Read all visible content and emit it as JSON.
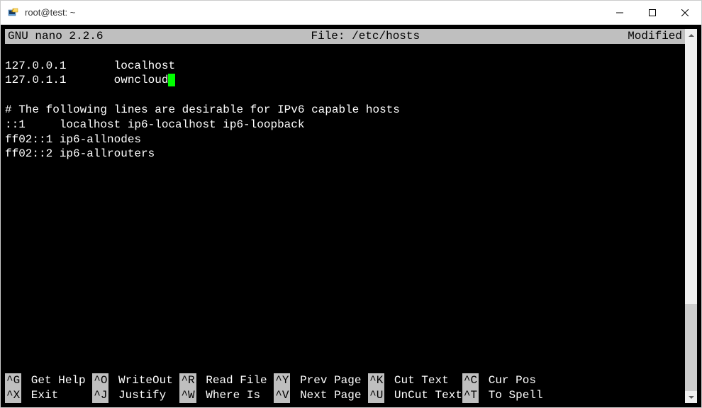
{
  "window": {
    "title": "root@test: ~"
  },
  "nano": {
    "version": "GNU nano 2.2.6",
    "file_label": "File: /etc/hosts",
    "status": "Modified"
  },
  "content": {
    "lines": [
      "",
      "127.0.0.1       localhost",
      "127.0.1.1       owncloud",
      "",
      "# The following lines are desirable for IPv6 capable hosts",
      "::1     localhost ip6-localhost ip6-loopback",
      "ff02::1 ip6-allnodes",
      "ff02::2 ip6-allrouters"
    ],
    "cursor_line": 2
  },
  "shortcuts": {
    "row1": [
      {
        "key": "^G",
        "label": "Get Help"
      },
      {
        "key": "^O",
        "label": "WriteOut"
      },
      {
        "key": "^R",
        "label": "Read File"
      },
      {
        "key": "^Y",
        "label": "Prev Page"
      },
      {
        "key": "^K",
        "label": "Cut Text"
      },
      {
        "key": "^C",
        "label": "Cur Pos"
      }
    ],
    "row2": [
      {
        "key": "^X",
        "label": "Exit"
      },
      {
        "key": "^J",
        "label": "Justify"
      },
      {
        "key": "^W",
        "label": "Where Is"
      },
      {
        "key": "^V",
        "label": "Next Page"
      },
      {
        "key": "^U",
        "label": "UnCut Text"
      },
      {
        "key": "^T",
        "label": "To Spell"
      }
    ]
  }
}
